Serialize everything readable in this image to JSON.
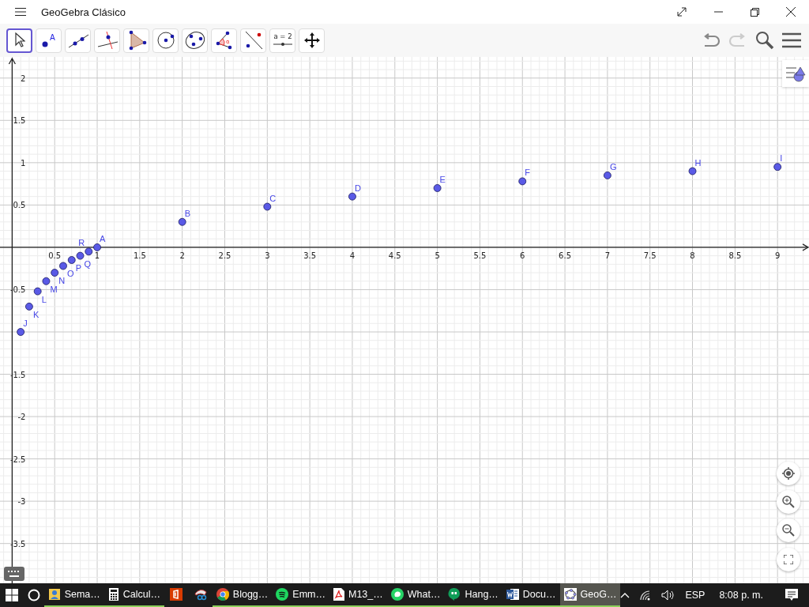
{
  "window": {
    "title": "GeoGebra Clásico"
  },
  "toolbar": {
    "tools": [
      {
        "kind": "move",
        "selected": true
      },
      {
        "kind": "point",
        "label": "A",
        "selected": false
      },
      {
        "kind": "line",
        "selected": false
      },
      {
        "kind": "perpendicular",
        "selected": false
      },
      {
        "kind": "polygon",
        "selected": false
      },
      {
        "kind": "circle",
        "selected": false
      },
      {
        "kind": "conic",
        "selected": false
      },
      {
        "kind": "angle",
        "label": "α",
        "selected": false
      },
      {
        "kind": "reflect",
        "selected": false
      },
      {
        "kind": "slider",
        "label": "a = 2",
        "selected": false
      },
      {
        "kind": "move-view",
        "selected": false
      }
    ]
  },
  "graphics": {
    "chart_data": {
      "type": "scatter",
      "grid": true,
      "xlim": [
        -0.143,
        9.37
      ],
      "ylim": [
        -3.97,
        2.25
      ],
      "xticks": [
        {
          "value": 0.5,
          "label": "0.5"
        },
        {
          "value": 1,
          "label": "1"
        },
        {
          "value": 1.5,
          "label": "1.5"
        },
        {
          "value": 2,
          "label": "2"
        },
        {
          "value": 2.5,
          "label": "2.5"
        },
        {
          "value": 3,
          "label": "3"
        },
        {
          "value": 3.5,
          "label": "3.5"
        },
        {
          "value": 4,
          "label": "4"
        },
        {
          "value": 4.5,
          "label": "4.5"
        },
        {
          "value": 5,
          "label": "5"
        },
        {
          "value": 5.5,
          "label": "5.5"
        },
        {
          "value": 6,
          "label": "6"
        },
        {
          "value": 6.5,
          "label": "6.5"
        },
        {
          "value": 7,
          "label": "7"
        },
        {
          "value": 7.5,
          "label": "7.5"
        },
        {
          "value": 8,
          "label": "8"
        },
        {
          "value": 8.5,
          "label": "8.5"
        },
        {
          "value": 9,
          "label": "9"
        }
      ],
      "yticks": [
        {
          "value": 2,
          "label": "2"
        },
        {
          "value": 1.5,
          "label": "1.5"
        },
        {
          "value": 1,
          "label": "1"
        },
        {
          "value": 0.5,
          "label": "0.5"
        },
        {
          "value": -0.5,
          "label": "-0.5"
        },
        {
          "value": -1.5,
          "label": "-1.5"
        },
        {
          "value": -2,
          "label": "-2"
        },
        {
          "value": -2.5,
          "label": "-2.5"
        },
        {
          "value": -3,
          "label": "-3"
        },
        {
          "value": -3.5,
          "label": "-3.5"
        }
      ],
      "x": [
        1,
        2,
        3,
        4,
        5,
        6,
        7,
        8,
        9,
        0.1,
        0.2,
        0.3,
        0.4,
        0.5,
        0.6,
        0.7,
        0.8,
        0.9
      ],
      "values": [
        0,
        0.3,
        0.48,
        0.6,
        0.7,
        0.78,
        0.85,
        0.9,
        0.95,
        -1,
        -0.7,
        -0.52,
        -0.4,
        -0.3,
        -0.22,
        -0.15,
        -0.1,
        -0.05
      ],
      "annotations": [
        {
          "x": 1,
          "y": 0,
          "text": "A"
        },
        {
          "x": 2,
          "y": 0.3,
          "text": "B"
        },
        {
          "x": 3,
          "y": 0.48,
          "text": "C"
        },
        {
          "x": 4,
          "y": 0.6,
          "text": "D"
        },
        {
          "x": 5,
          "y": 0.7,
          "text": "E"
        },
        {
          "x": 6,
          "y": 0.78,
          "text": "F"
        },
        {
          "x": 7,
          "y": 0.85,
          "text": "G"
        },
        {
          "x": 8,
          "y": 0.9,
          "text": "H"
        },
        {
          "x": 9,
          "y": 0.95,
          "text": "I"
        },
        {
          "x": 0.1,
          "y": -1,
          "text": "J"
        },
        {
          "x": 0.2,
          "y": -0.7,
          "text": "K"
        },
        {
          "x": 0.3,
          "y": -0.52,
          "text": "L"
        },
        {
          "x": 0.4,
          "y": -0.4,
          "text": "M"
        },
        {
          "x": 0.5,
          "y": -0.3,
          "text": "N"
        },
        {
          "x": 0.6,
          "y": -0.22,
          "text": "O"
        },
        {
          "x": 0.7,
          "y": -0.15,
          "text": "P"
        },
        {
          "x": 0.8,
          "y": -0.1,
          "text": "Q"
        },
        {
          "x": 0.9,
          "y": -0.05,
          "text": "R"
        }
      ]
    }
  },
  "taskbar": {
    "items": [
      {
        "kind": "contact",
        "label": "Sema…",
        "open": true,
        "selected": false
      },
      {
        "kind": "calculator",
        "label": "Calcul…",
        "open": true,
        "selected": false
      },
      {
        "kind": "office",
        "open": false,
        "selected": false
      },
      {
        "kind": "snip",
        "open": false,
        "selected": false
      },
      {
        "kind": "chrome",
        "label": "Blogg…",
        "open": true,
        "selected": false
      },
      {
        "kind": "spotify",
        "label": "Emm…",
        "open": true,
        "selected": false
      },
      {
        "kind": "pdf",
        "label": "M13_…",
        "open": true,
        "selected": false
      },
      {
        "kind": "whatsapp",
        "label": "What…",
        "open": true,
        "selected": false
      },
      {
        "kind": "hangouts",
        "label": "Hang…",
        "open": true,
        "selected": false
      },
      {
        "kind": "word",
        "label": "Docu…",
        "open": true,
        "selected": false
      },
      {
        "kind": "geogebra",
        "label": "GeoG…",
        "open": true,
        "selected": true
      }
    ],
    "language": "ESP",
    "clock": "8:08 p. m."
  }
}
